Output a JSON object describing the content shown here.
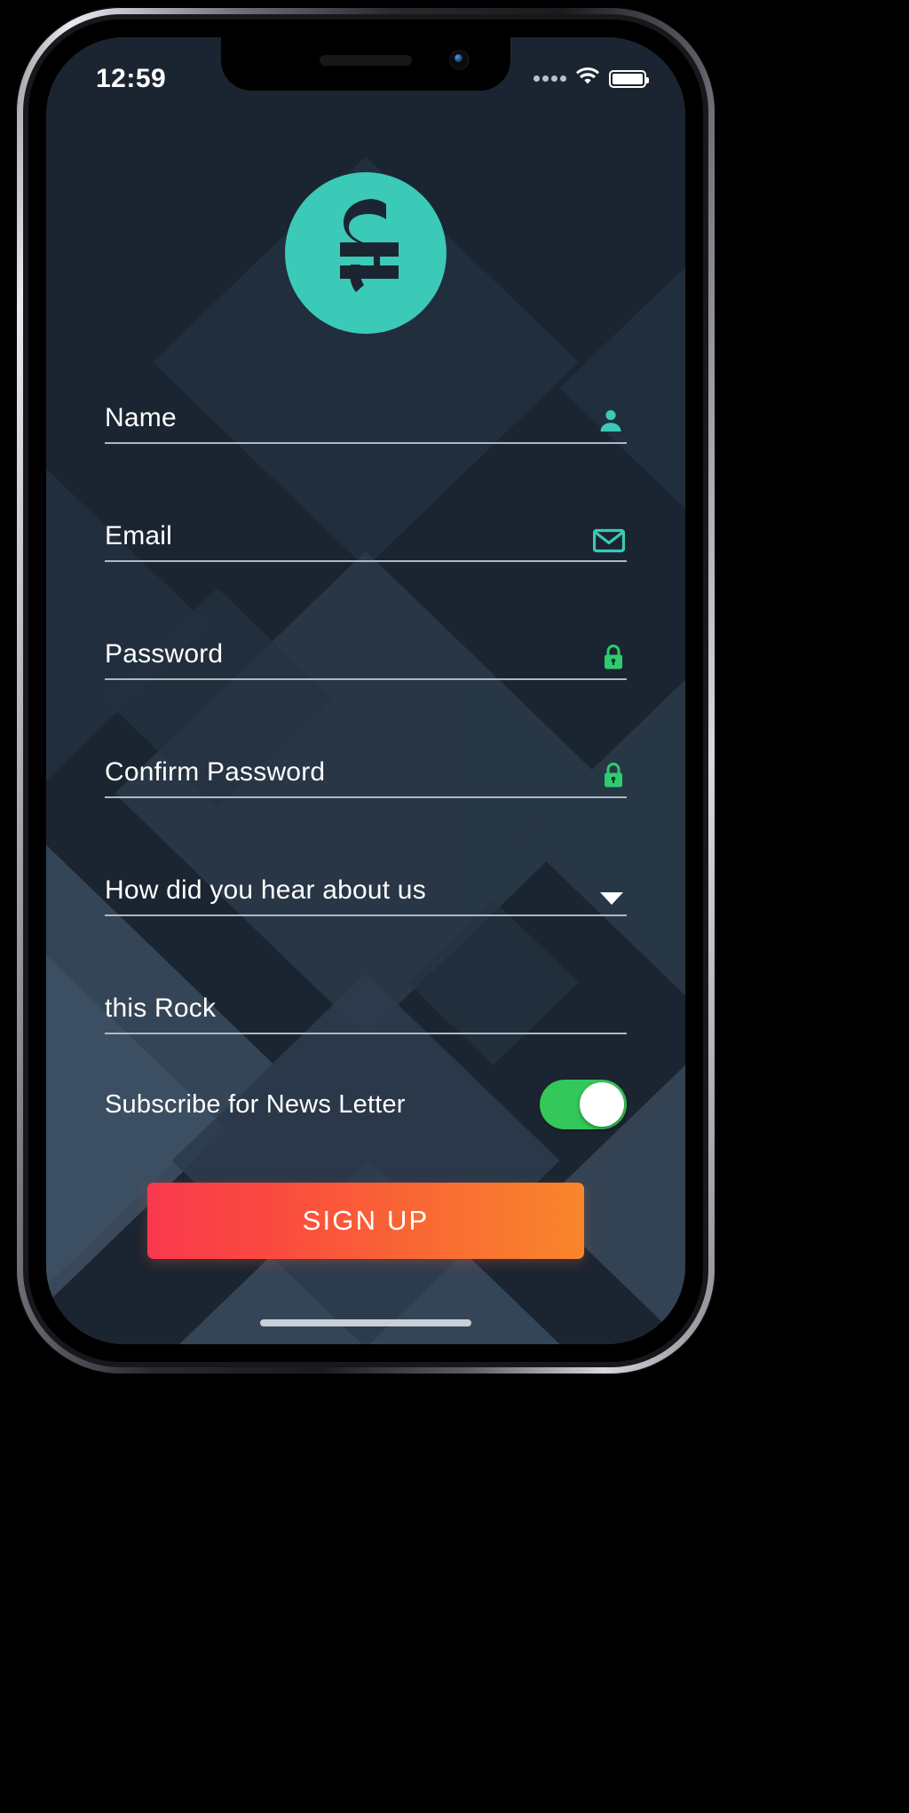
{
  "status_bar": {
    "time": "12:59",
    "signal_icon": "signal-dots-icon",
    "wifi_icon": "wifi-icon",
    "battery_icon": "battery-full-icon"
  },
  "brand": {
    "logo_icon": "sz-monogram-logo",
    "logo_color": "#3bc9b8",
    "logo_mark_color": "#1b2531"
  },
  "theme": {
    "screen_background": "#1b2531",
    "underline_color": "#aeb9c4",
    "text_color": "#ffffff",
    "accent_teal": "#3bc9b8",
    "lock_green": "#2ecc71",
    "toggle_on_color": "#34c759",
    "button_gradient_start": "#f9394d",
    "button_gradient_end": "#f9862c"
  },
  "form": {
    "fields": [
      {
        "name": "name",
        "label": "Name",
        "value": "",
        "placeholder": "Name",
        "icon": "person-icon",
        "icon_color": "#3bc9b8"
      },
      {
        "name": "email",
        "label": "Email",
        "value": "",
        "placeholder": "Email",
        "icon": "envelope-icon",
        "icon_color": "#3bc9b8"
      },
      {
        "name": "password",
        "label": "Password",
        "value": "",
        "placeholder": "Password",
        "icon": "lock-icon",
        "icon_color": "#2ecc71"
      },
      {
        "name": "confirm-password",
        "label": "Confirm Password",
        "value": "",
        "placeholder": "Confirm Password",
        "icon": "lock-icon",
        "icon_color": "#2ecc71"
      },
      {
        "name": "referral-source",
        "label": "How did you hear about us",
        "value": "",
        "placeholder": "How did you hear about us",
        "icon": "chevron-down-icon",
        "icon_color": "#ffffff"
      },
      {
        "name": "other-source",
        "label": "this Rock",
        "value": "this Rock",
        "placeholder": "",
        "icon": "",
        "icon_color": ""
      }
    ],
    "newsletter": {
      "label": "Subscribe for News Letter",
      "toggle_state": "on"
    },
    "submit_label": "SIGN UP"
  }
}
